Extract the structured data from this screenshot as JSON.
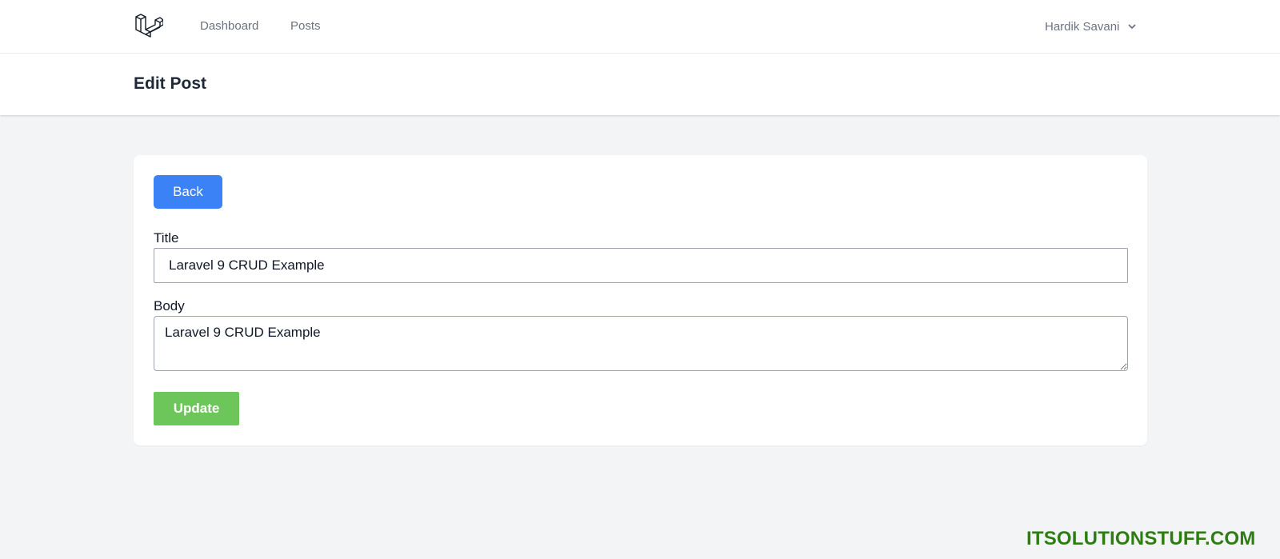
{
  "nav": {
    "links": [
      "Dashboard",
      "Posts"
    ],
    "user_name": "Hardik Savani",
    "logo_icon": "laravel-logo-icon",
    "user_menu_icon": "chevron-down-icon"
  },
  "header": {
    "title": "Edit Post"
  },
  "form": {
    "back_label": "Back",
    "title_label": "Title",
    "title_value": "Laravel 9 CRUD Example",
    "body_label": "Body",
    "body_value": "Laravel 9 CRUD Example",
    "update_label": "Update"
  },
  "watermark": "ITSOLUTIONSTUFF.COM",
  "colors": {
    "back_button": "#3b82f6",
    "update_button": "#6cc65a",
    "watermark": "#2e7d12",
    "page_background": "#f3f4f6"
  }
}
